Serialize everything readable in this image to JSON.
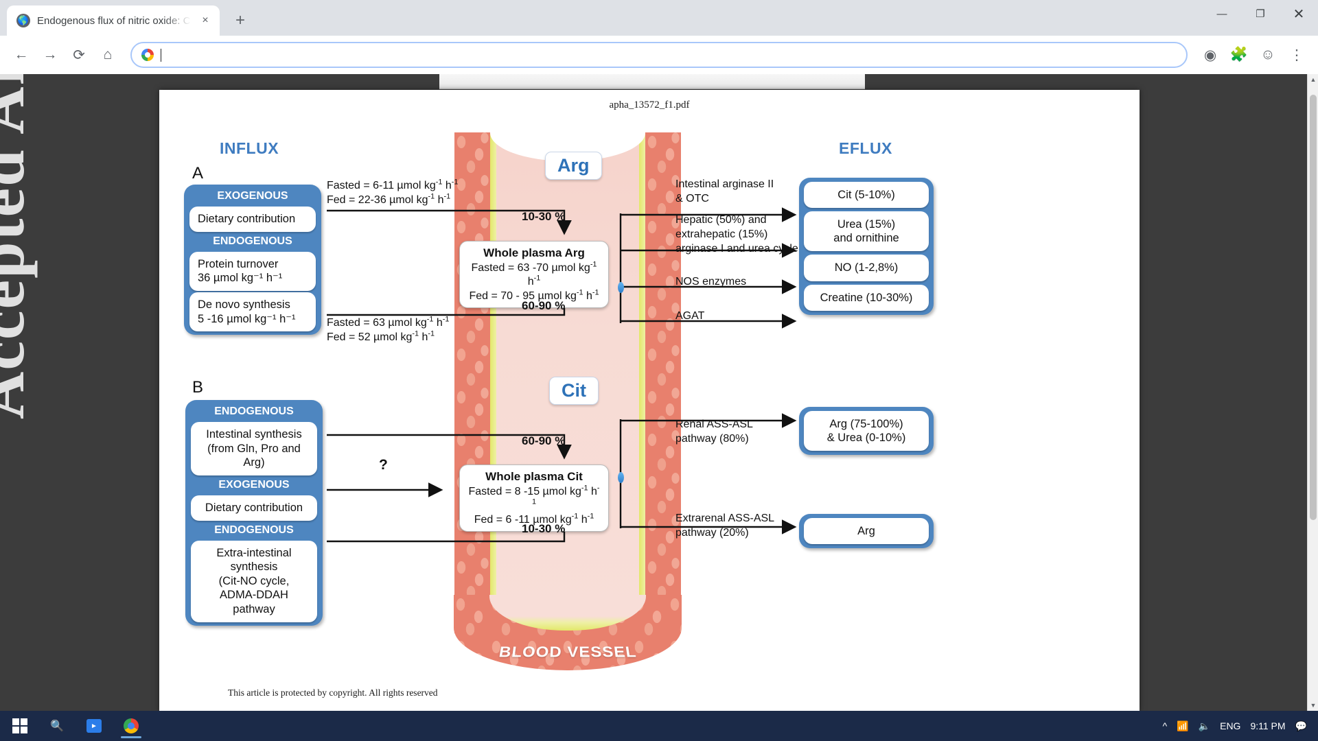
{
  "browser": {
    "tab": {
      "title": "Endogenous flux of nitric oxide: C",
      "favicon": "globe-icon",
      "close": "×"
    },
    "new_tab": "+",
    "window_controls": {
      "minimize": "—",
      "maximize": "❐",
      "close": "✕"
    },
    "nav": {
      "back": "←",
      "forward": "→",
      "reload": "⟳",
      "home": "⌂"
    },
    "omnibox": {
      "value": "",
      "placeholder": "",
      "search_icon": "google-g-icon"
    },
    "toolbar_right": {
      "share": "share-icon",
      "extensions": "puzzle-icon",
      "profile": "account-icon",
      "menu": "⋮"
    }
  },
  "pdf": {
    "filename": "apha_13572_f1.pdf",
    "copyright": "This article is protected by copyright. All rights reserved",
    "watermark": "Accepted Article"
  },
  "figure": {
    "headers": {
      "influx": "INFLUX",
      "eflux": "EFLUX"
    },
    "vessel_label": "BLOOD VESSEL",
    "panels": [
      {
        "letter": "A",
        "molecule": "Arg",
        "influx_box": [
          {
            "section": "EXOGENOUS",
            "items": [
              "Dietary contribution"
            ]
          },
          {
            "section": "ENDOGENOUS",
            "items": [
              "Protein turnover\n36 µmol kg⁻¹ h⁻¹",
              "De novo synthesis\n5 -16 µmol kg⁻¹ h⁻¹"
            ]
          }
        ],
        "influx_flux_top": {
          "fasted": "Fasted = 6-11 µmol kg",
          "fed": "Fed = 22-36 µmol kg"
        },
        "influx_flux_bottom": {
          "fasted": "Fasted = 63 µmol kg",
          "fed": "Fed = 52 µmol kg"
        },
        "pct_top": "10-30 %",
        "pct_bottom": "60-90 %",
        "plasma_pool": {
          "title": "Whole plasma Arg",
          "fasted": "Fasted = 63 -70 µmol kg",
          "fed": "Fed = 70 - 95 µmol kg"
        },
        "efflux_pathways": [
          "Intestinal arginase II\n& OTC",
          "Hepatic (50%) and\nextrahepatic (15%)\narginase I and urea cycle",
          "NOS enzymes",
          "AGAT"
        ],
        "efflux_products": [
          "Cit (5-10%)",
          "Urea (15%)\nand  ornithine",
          "NO (1-2,8%)",
          "Creatine (10-30%)"
        ]
      },
      {
        "letter": "B",
        "molecule": "Cit",
        "influx_box": [
          {
            "section": "ENDOGENOUS",
            "items": [
              "Intestinal synthesis\n(from Gln, Pro and Arg)"
            ]
          },
          {
            "section": "EXOGENOUS",
            "items": [
              "Dietary contribution"
            ]
          },
          {
            "section": "ENDOGENOUS",
            "items": [
              "Extra-intestinal synthesis\n(Cit-NO cycle,\nADMA-DDAH pathway"
            ]
          }
        ],
        "question_mark": "?",
        "pct_top": "60-90 %",
        "pct_bottom": "10-30 %",
        "plasma_pool": {
          "title": "Whole plasma Cit",
          "fasted": "Fasted = 8 -15 µmol kg",
          "fed": "Fed = 6 -11 µmol kg"
        },
        "efflux_pathways": [
          "Renal ASS-ASL\npathway (80%)",
          "Extrarenal ASS-ASL\npathway (20%)"
        ],
        "efflux_products": [
          "Arg (75-100%)\n& Urea (0-10%)",
          "Arg"
        ]
      }
    ],
    "units_suffix": "⁻¹ h⁻¹"
  },
  "taskbar": {
    "start": "windows-logo-icon",
    "search": "search-icon",
    "apps": [
      "media-player-icon",
      "chrome-icon"
    ],
    "tray": {
      "chevron": "^",
      "network": "wifi-icon",
      "volume": "speaker-icon",
      "language": "ENG",
      "time": "9:11 PM",
      "notifications": "notification-icon"
    }
  },
  "colors": {
    "accent_blue": "#4e86c0",
    "header_blue": "#3f7cc0",
    "vessel_wall": "#e8806d",
    "vessel_lumen": "#f7dbd4",
    "endothelium": "#e3e86a",
    "taskbar": "#1b2a48"
  }
}
